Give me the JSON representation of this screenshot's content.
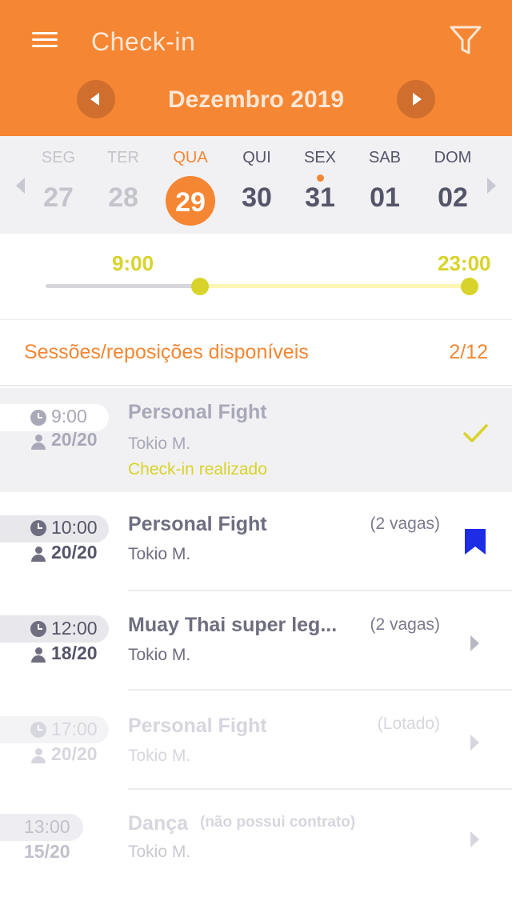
{
  "header": {
    "title": "Check-in",
    "month": "Dezembro 2019",
    "bg_color": "#f58633",
    "icons": {
      "menu": "hamburger-menu-icon",
      "filter": "filter-funnel-icon",
      "prev": "chevron-left-icon",
      "next": "chevron-right-icon"
    }
  },
  "week": {
    "days": [
      {
        "name": "SEG",
        "num": "27",
        "state": "past"
      },
      {
        "name": "TER",
        "num": "28",
        "state": "past"
      },
      {
        "name": "QUA",
        "num": "29",
        "state": "selected"
      },
      {
        "name": "QUI",
        "num": "30",
        "state": "normal"
      },
      {
        "name": "SEX",
        "num": "31",
        "state": "normal",
        "has_dot": true
      },
      {
        "name": "SAB",
        "num": "01",
        "state": "normal"
      },
      {
        "name": "DOM",
        "num": "02",
        "state": "normal"
      }
    ]
  },
  "time_filter": {
    "start": "9:00",
    "end": "23:00",
    "accent_color": "#d8d32a"
  },
  "sessions": {
    "title": "Sessões/reposições disponíveis",
    "count": "2/12"
  },
  "classes": [
    {
      "time": "9:00",
      "capacity": "20/20",
      "name": "Personal Fight",
      "teacher": "Tokio M.",
      "status": "Check-in realizado",
      "vagas": "",
      "state": "done",
      "action_icon": "checkmark-icon"
    },
    {
      "time": "10:00",
      "capacity": "20/20",
      "name": "Personal Fight",
      "teacher": "Tokio M.",
      "vagas": "(2 vagas)",
      "state": "booked",
      "action_icon": "bookmark-icon"
    },
    {
      "time": "12:00",
      "capacity": "18/20",
      "name": "Muay Thai super leg...",
      "teacher": "Tokio M.",
      "vagas": "(2 vagas)",
      "state": "available",
      "action_icon": "chevron-right-icon"
    },
    {
      "time": "17:00",
      "capacity": "20/20",
      "name": "Personal Fight",
      "teacher": "Tokio M.",
      "vagas": "(Lotado)",
      "state": "full",
      "action_icon": "chevron-right-icon"
    },
    {
      "time": "13:00",
      "capacity": "15/20",
      "name": "Dança",
      "note": "(não possui contrato)",
      "teacher": "Tokio M.",
      "state": "nocontract",
      "action_icon": "chevron-right-icon"
    }
  ]
}
